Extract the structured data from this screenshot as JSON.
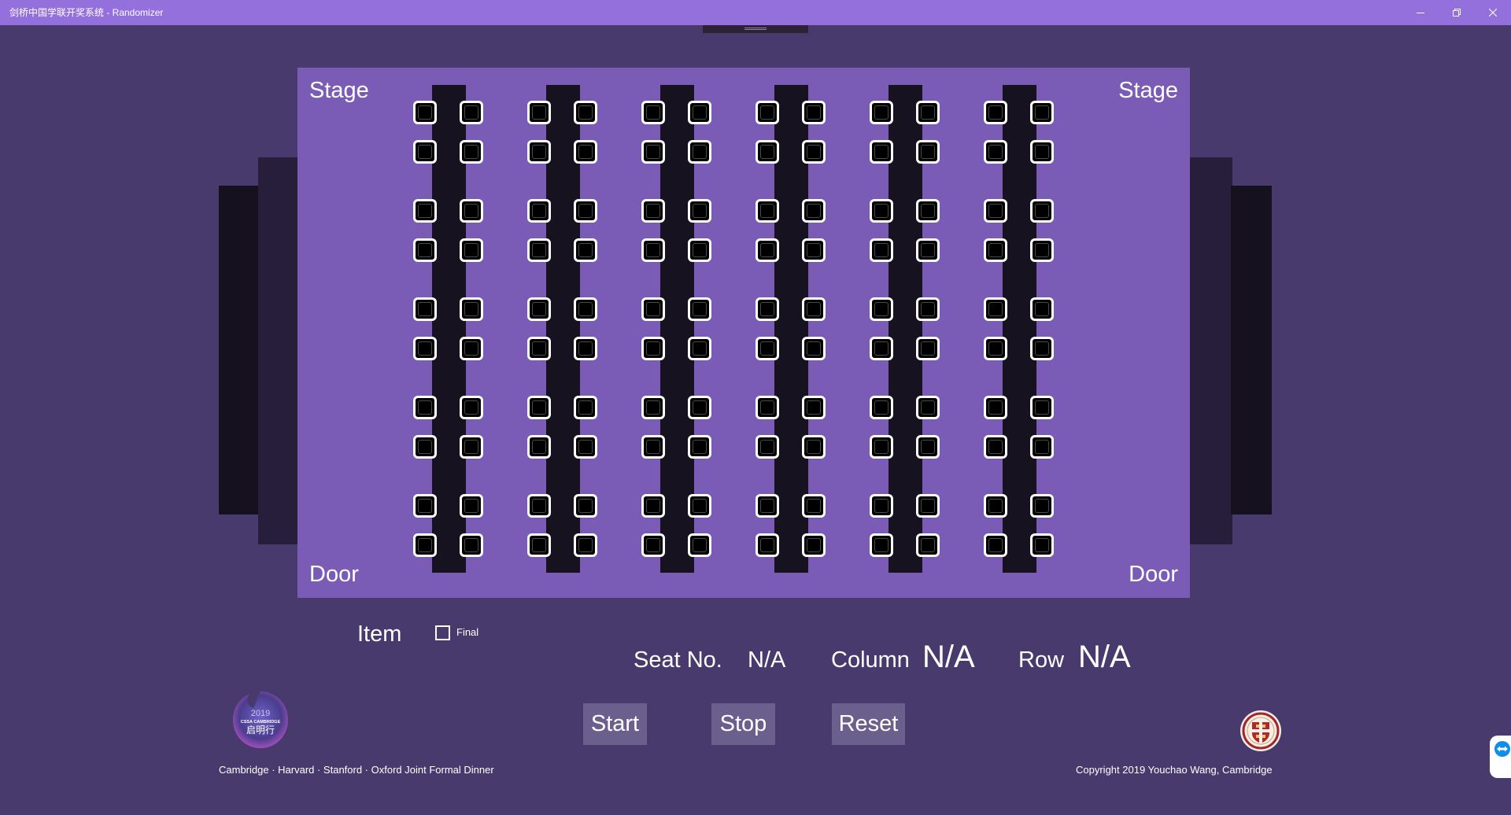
{
  "window": {
    "title": "剑桥中国学联开奖系统 - Randomizer"
  },
  "hall": {
    "stage_left": "Stage",
    "stage_right": "Stage",
    "door_left": "Door",
    "door_right": "Door",
    "table_count": 6,
    "seat_rows_per_side": 10
  },
  "controls": {
    "item_label": "Item",
    "final_label": "Final",
    "final_checked": false
  },
  "result": {
    "seat_label": "Seat No.",
    "seat_value": "N/A",
    "column_label": "Column",
    "column_value": "N/A",
    "row_label": "Row",
    "row_value": "N/A"
  },
  "actions": {
    "start": "Start",
    "stop": "Stop",
    "reset": "Reset"
  },
  "logo_left": {
    "year": "2019",
    "line": "CSSA CAMBRIDGE",
    "chinese": "启明行"
  },
  "footer": {
    "left": "Cambridge · Harvard · Stanford · Oxford Joint Formal Dinner",
    "right": "Copyright 2019 Youchao Wang, Cambridge"
  },
  "colors": {
    "titlebar": "#9470dc",
    "background": "#483a6c",
    "hall": "#7a5cb6",
    "table": "#17121f",
    "button": "#6b5f8d"
  },
  "icons": {
    "minimize": "minimize-icon",
    "maximize": "restore-icon",
    "close": "close-icon",
    "edge_widget": "teamviewer-icon"
  }
}
